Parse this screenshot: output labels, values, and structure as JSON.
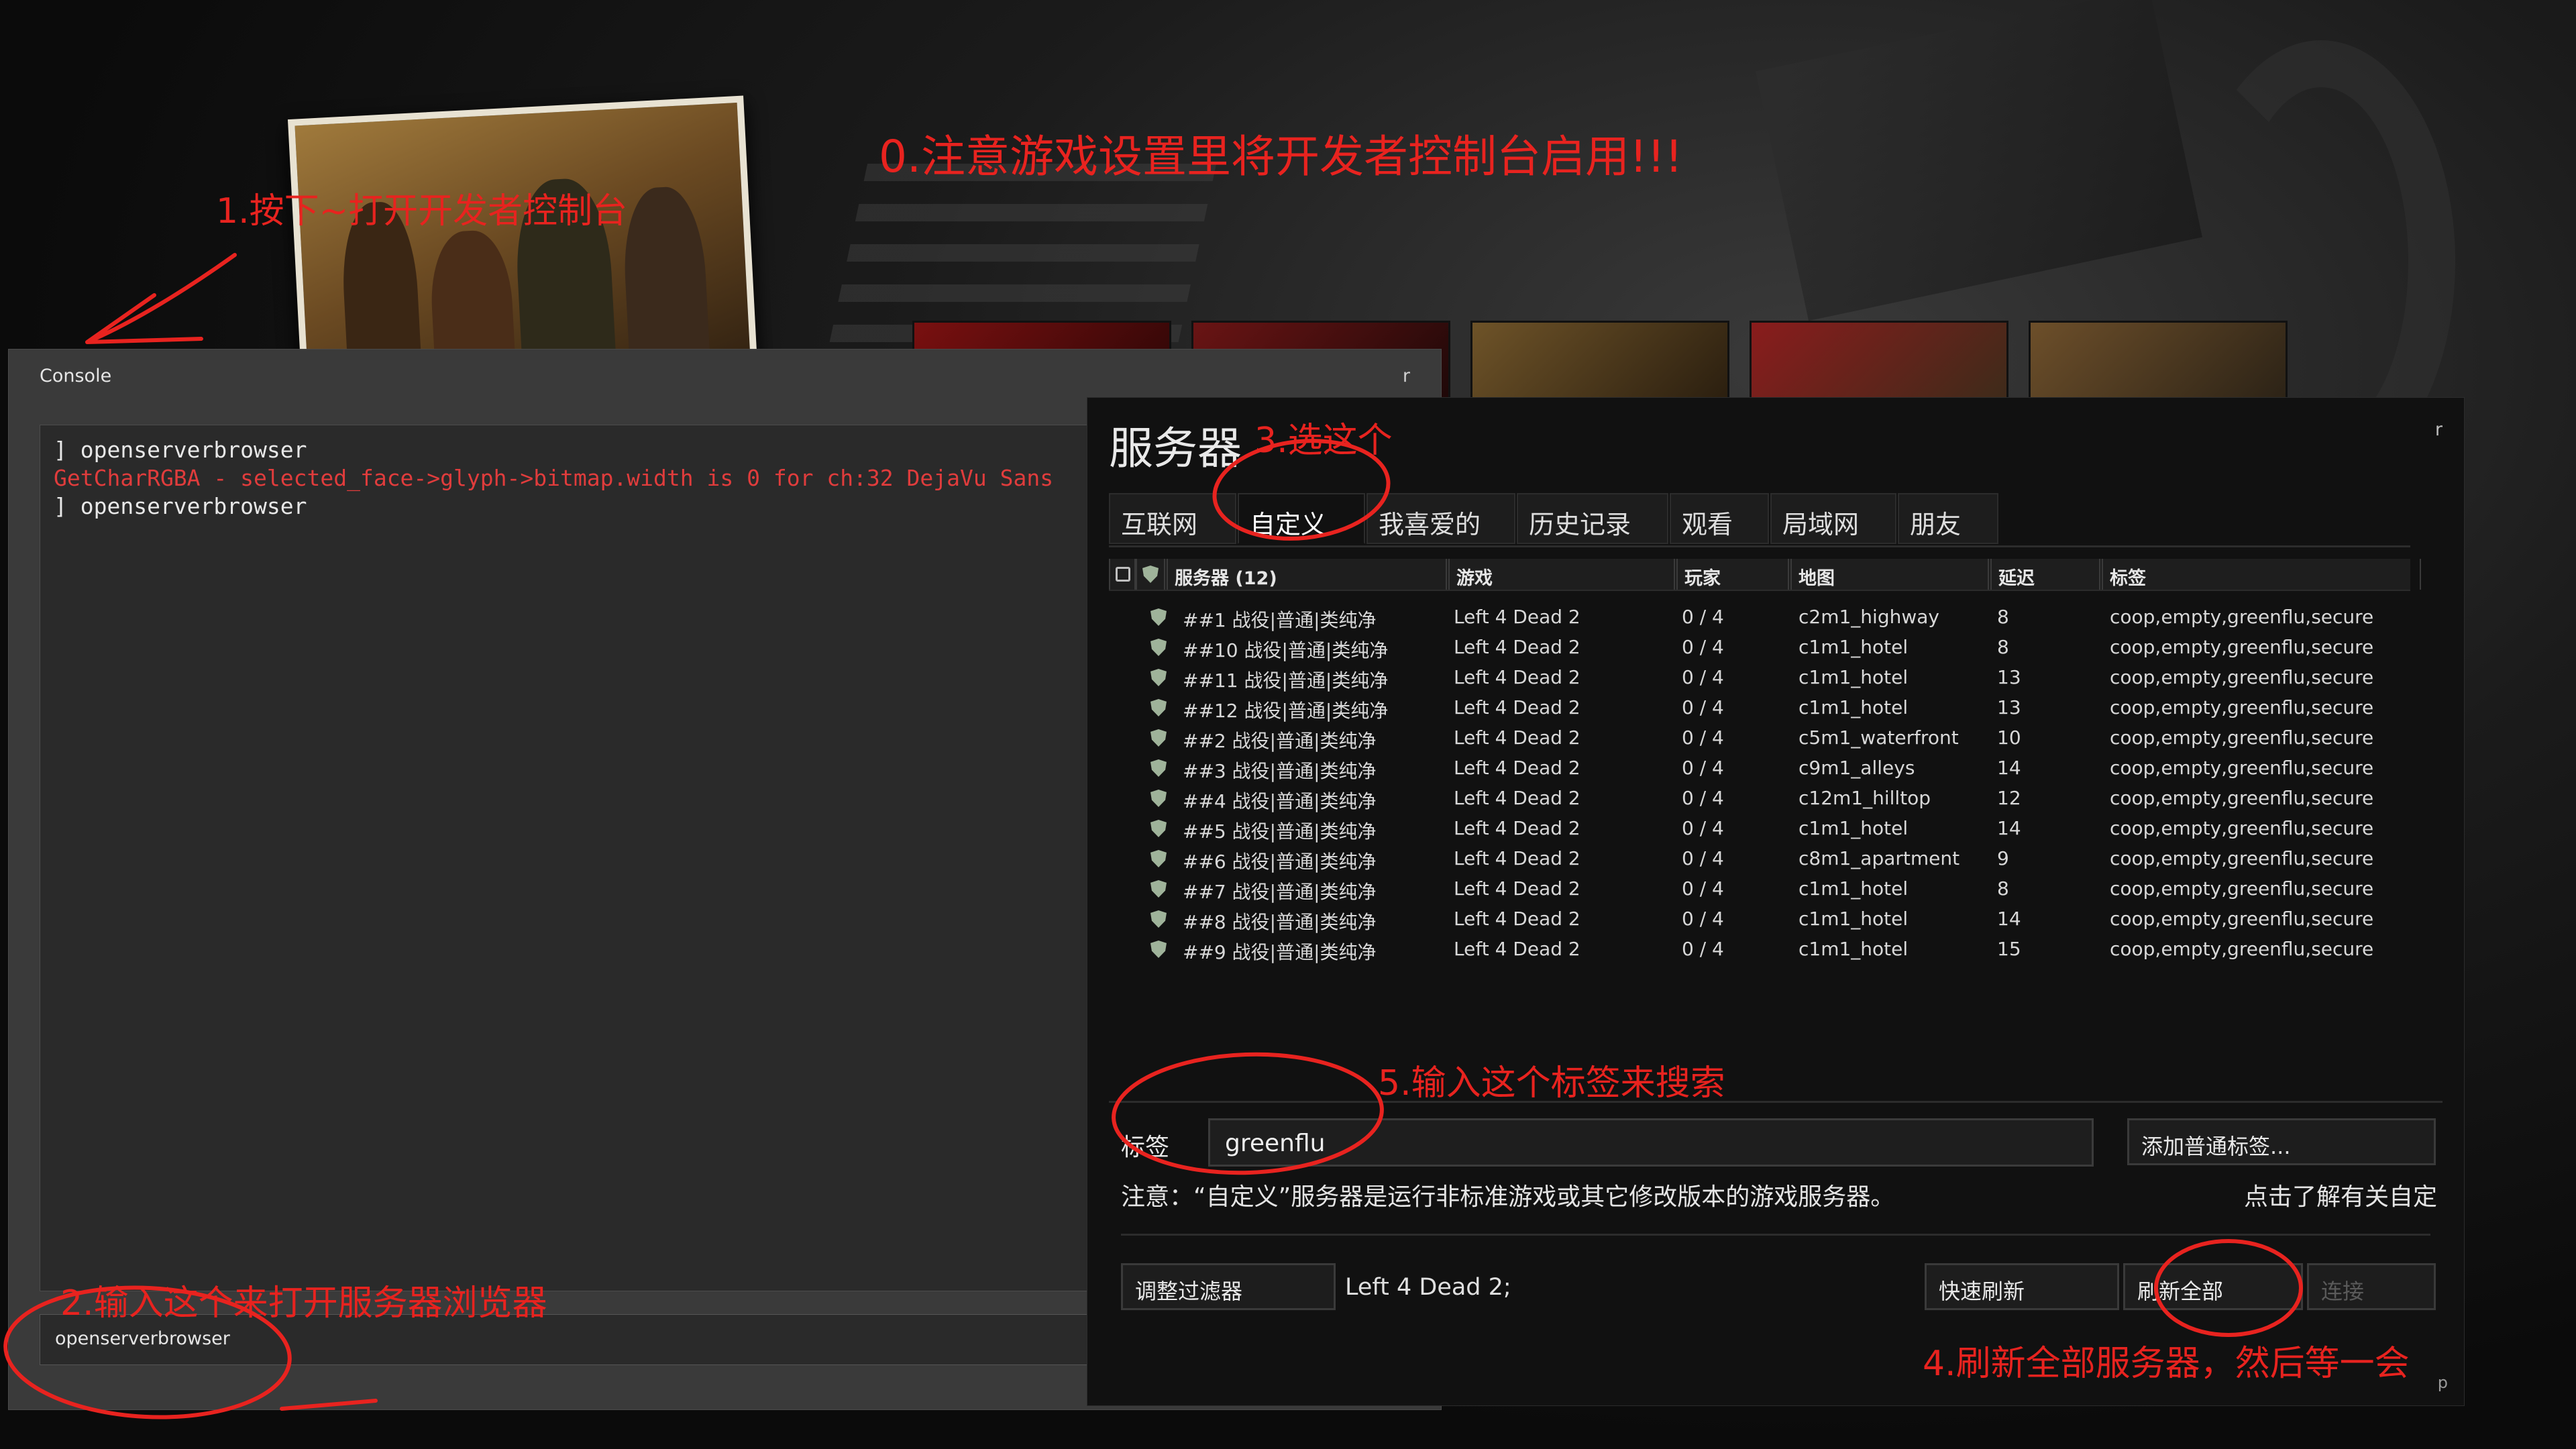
{
  "annotations": {
    "step0": "0.注意游戏设置里将开发者控制台启用!!!",
    "step1": "1.按下~打开开发者控制台",
    "step2": "2.输入这个来打开服务器浏览器",
    "step3": "3.选这个",
    "step4": "4.刷新全部服务器，然后等一会",
    "step5": "5.输入这个标签来搜索"
  },
  "console": {
    "title": "Console",
    "close_glyph": "r",
    "log": [
      {
        "text": "] openserverbrowser",
        "kind": "cmd"
      },
      {
        "text": "GetCharRGBA - selected_face->glyph->bitmap.width is 0 for ch:32 DejaVu Sans",
        "kind": "err"
      },
      {
        "text": "] openserverbrowser",
        "kind": "cmd"
      }
    ],
    "input_value": "openserverbrowser"
  },
  "server_browser": {
    "title": "服务器",
    "close_glyph": "r",
    "resize_glyph": "p",
    "tabs": [
      "互联网",
      "自定义",
      "我喜爱的",
      "历史记录",
      "观看",
      "局域网",
      "朋友"
    ],
    "active_tab": "自定义",
    "columns": {
      "name": "服务器 (12)",
      "game": "游戏",
      "players": "玩家",
      "map": "地图",
      "latency": "延迟",
      "tags": "标签"
    },
    "rows": [
      {
        "name": "##1 战役|普通|类纯净",
        "game": "Left 4 Dead 2",
        "players": "0 / 4",
        "map": "c2m1_highway",
        "latency": "8",
        "tags": "coop,empty,greenflu,secure"
      },
      {
        "name": "##10 战役|普通|类纯净",
        "game": "Left 4 Dead 2",
        "players": "0 / 4",
        "map": "c1m1_hotel",
        "latency": "8",
        "tags": "coop,empty,greenflu,secure"
      },
      {
        "name": "##11 战役|普通|类纯净",
        "game": "Left 4 Dead 2",
        "players": "0 / 4",
        "map": "c1m1_hotel",
        "latency": "13",
        "tags": "coop,empty,greenflu,secure"
      },
      {
        "name": "##12 战役|普通|类纯净",
        "game": "Left 4 Dead 2",
        "players": "0 / 4",
        "map": "c1m1_hotel",
        "latency": "13",
        "tags": "coop,empty,greenflu,secure"
      },
      {
        "name": "##2 战役|普通|类纯净",
        "game": "Left 4 Dead 2",
        "players": "0 / 4",
        "map": "c5m1_waterfront",
        "latency": "10",
        "tags": "coop,empty,greenflu,secure"
      },
      {
        "name": "##3 战役|普通|类纯净",
        "game": "Left 4 Dead 2",
        "players": "0 / 4",
        "map": "c9m1_alleys",
        "latency": "14",
        "tags": "coop,empty,greenflu,secure"
      },
      {
        "name": "##4 战役|普通|类纯净",
        "game": "Left 4 Dead 2",
        "players": "0 / 4",
        "map": "c12m1_hilltop",
        "latency": "12",
        "tags": "coop,empty,greenflu,secure"
      },
      {
        "name": "##5 战役|普通|类纯净",
        "game": "Left 4 Dead 2",
        "players": "0 / 4",
        "map": "c1m1_hotel",
        "latency": "14",
        "tags": "coop,empty,greenflu,secure"
      },
      {
        "name": "##6 战役|普通|类纯净",
        "game": "Left 4 Dead 2",
        "players": "0 / 4",
        "map": "c8m1_apartment",
        "latency": "9",
        "tags": "coop,empty,greenflu,secure"
      },
      {
        "name": "##7 战役|普通|类纯净",
        "game": "Left 4 Dead 2",
        "players": "0 / 4",
        "map": "c1m1_hotel",
        "latency": "8",
        "tags": "coop,empty,greenflu,secure"
      },
      {
        "name": "##8 战役|普通|类纯净",
        "game": "Left 4 Dead 2",
        "players": "0 / 4",
        "map": "c1m1_hotel",
        "latency": "14",
        "tags": "coop,empty,greenflu,secure"
      },
      {
        "name": "##9 战役|普通|类纯净",
        "game": "Left 4 Dead 2",
        "players": "0 / 4",
        "map": "c1m1_hotel",
        "latency": "15",
        "tags": "coop,empty,greenflu,secure"
      }
    ],
    "tag_label": "标签",
    "tag_value": "greenflu",
    "add_tag_button": "添加普通标签...",
    "note": "注意：“自定义”服务器是运行非标准游戏或其它修改版本的游戏服务器。",
    "learn_more": "点击了解有关自定",
    "filter_button": "调整过滤器",
    "filter_text": "Left 4 Dead 2;",
    "quick_refresh": "快速刷新",
    "refresh_all": "刷新全部",
    "connect": "连接"
  },
  "colors": {
    "annotation": "#e8231f",
    "error_text": "#e03c3c",
    "window_bg": "#111111",
    "console_bg": "#3a3a3a"
  }
}
